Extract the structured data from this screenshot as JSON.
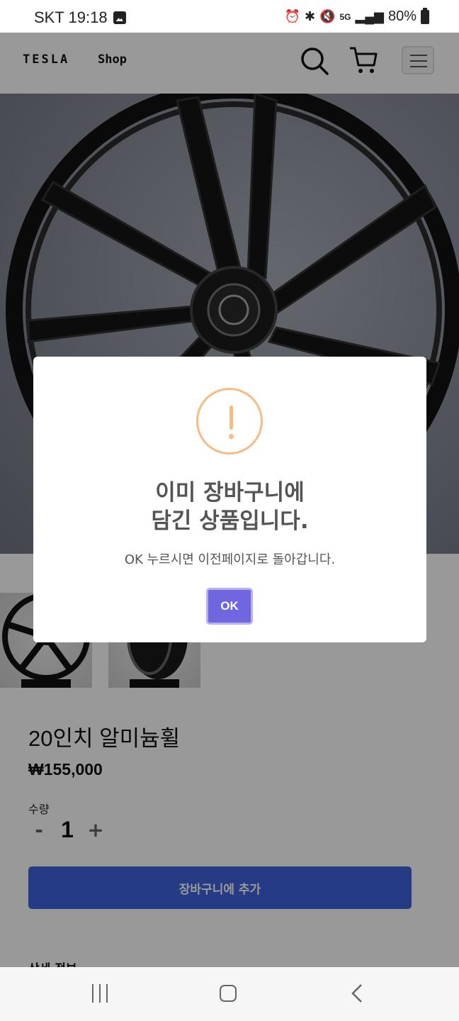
{
  "status_bar": {
    "carrier_time": "SKT 19:18",
    "battery": "80%",
    "icons": [
      "gallery-icon",
      "alarm-icon",
      "bluetooth-icon",
      "mute-icon",
      "5g-icon",
      "signal-icon",
      "battery-icon"
    ]
  },
  "header": {
    "logo": "TESLA",
    "shop_link": "Shop"
  },
  "product": {
    "title": "20인치 알미늄휠",
    "price": "₩155,000",
    "quantity_label": "수량",
    "quantity_minus": "-",
    "quantity_value": "1",
    "quantity_plus": "+",
    "add_to_cart": "장바구니에 추가",
    "details_heading": "상세 정보"
  },
  "modal": {
    "title_line1": "이미 장바구니에",
    "title_line2": "담긴 상품입니다.",
    "text": "OK 누르시면 이전페이지로 돌아갑니다.",
    "ok_button": "OK",
    "icon": "warning-icon",
    "accent_color": "#f8bb86",
    "button_color": "#7066e0"
  },
  "colors": {
    "primary_button": "#3e63dd"
  }
}
